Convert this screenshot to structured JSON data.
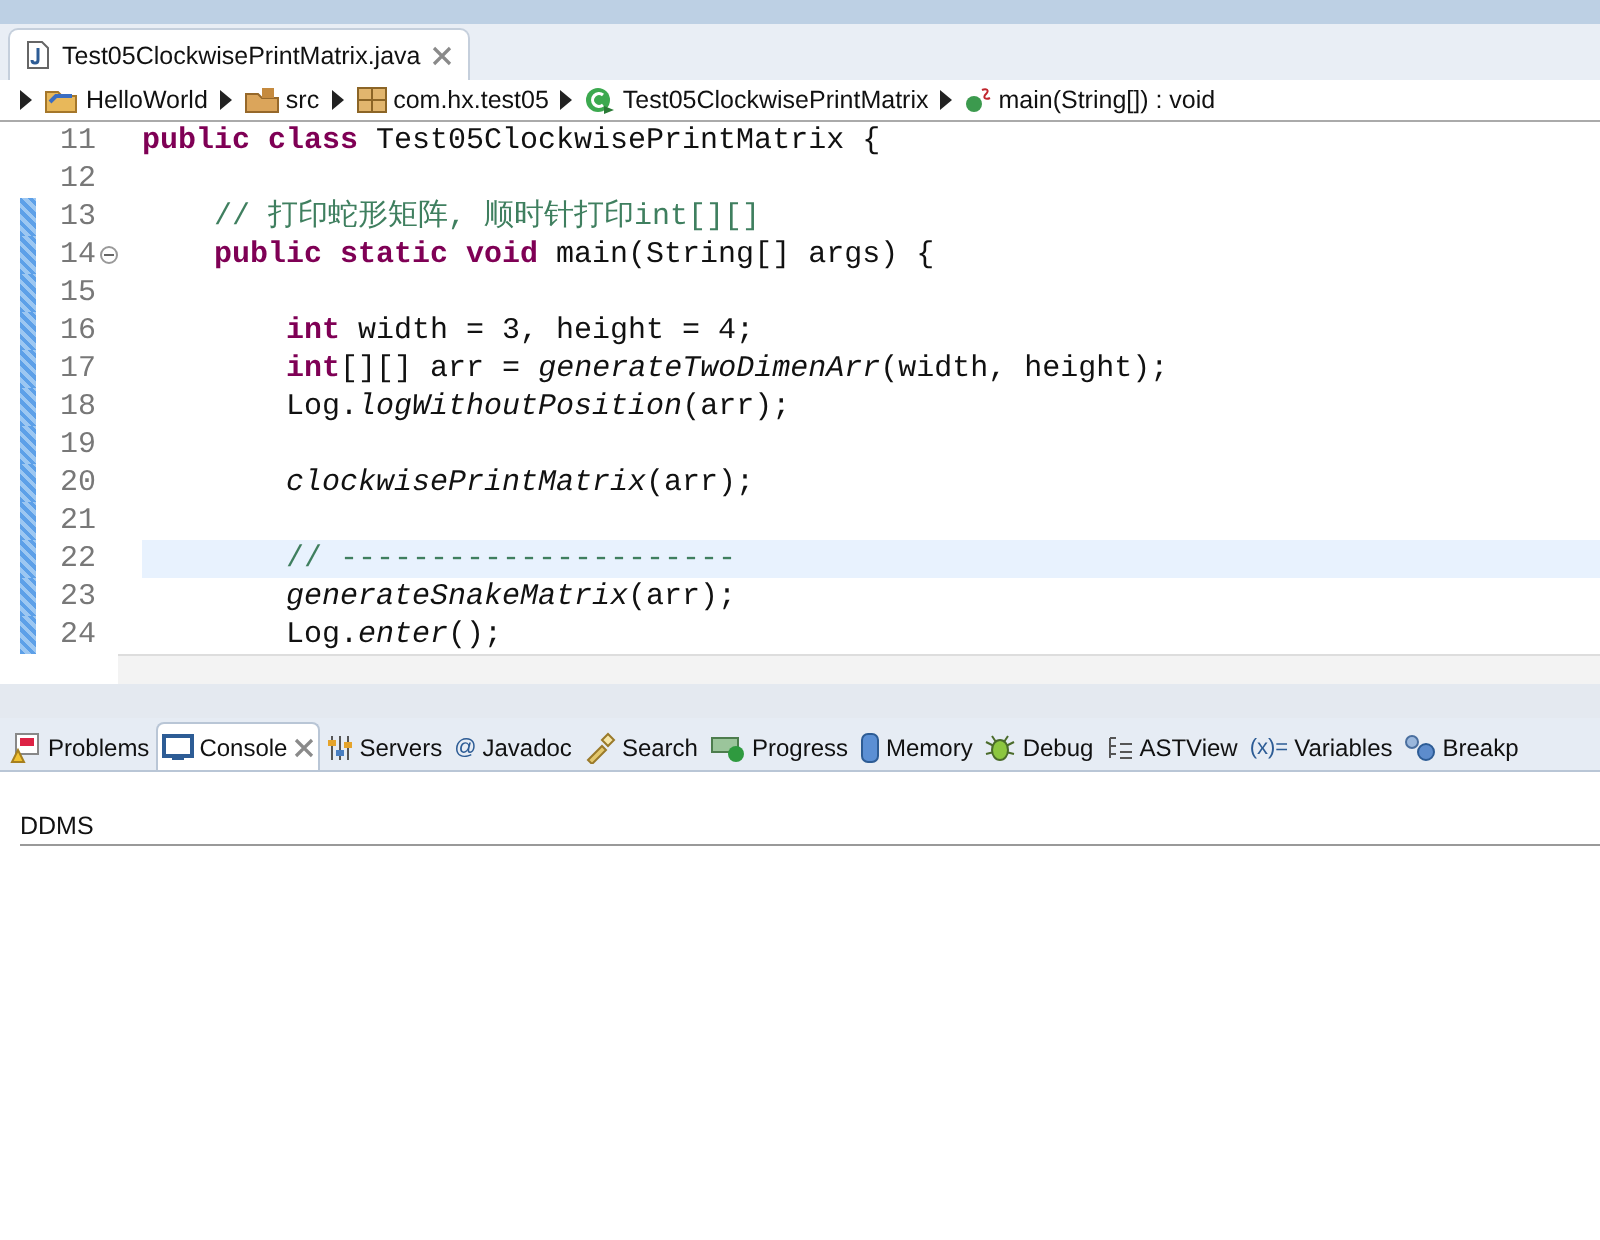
{
  "editor_tab": {
    "label": "Test05ClockwisePrintMatrix.java",
    "selected": true
  },
  "breadcrumb": [
    {
      "kind": "project",
      "label": "HelloWorld"
    },
    {
      "kind": "folder",
      "label": "src"
    },
    {
      "kind": "package",
      "label": "com.hx.test05"
    },
    {
      "kind": "class",
      "label": "Test05ClockwisePrintMatrix"
    },
    {
      "kind": "method",
      "label": "main(String[]) : void"
    }
  ],
  "code_lines": [
    {
      "number": "11",
      "changed": false,
      "current": false,
      "fold": false,
      "tokens": [
        {
          "kind": "keyword",
          "text": "public class "
        },
        {
          "kind": "plain",
          "text": "Test05ClockwisePrintMatrix {"
        }
      ]
    },
    {
      "number": "12",
      "changed": false,
      "current": false,
      "fold": false
    },
    {
      "number": "13",
      "changed": true,
      "current": false,
      "fold": false,
      "tokens": [
        {
          "kind": "comment",
          "text": "    // 打印蛇形矩阵, 顺时针打印int[][]"
        }
      ]
    },
    {
      "number": "14",
      "changed": true,
      "current": false,
      "fold": true,
      "tokens": [
        {
          "kind": "keyword",
          "text": "    public static void "
        },
        {
          "kind": "plain",
          "text": "main(String[] args) {"
        }
      ]
    },
    {
      "number": "15",
      "changed": true,
      "current": false,
      "fold": false
    },
    {
      "number": "16",
      "changed": true,
      "current": false,
      "fold": false,
      "tokens": [
        {
          "kind": "keyword",
          "text": "        int "
        },
        {
          "kind": "plain",
          "text": "width = 3, height = 4;"
        }
      ]
    },
    {
      "number": "17",
      "changed": true,
      "current": false,
      "fold": false,
      "tokens": [
        {
          "kind": "keyword",
          "text": "        int"
        },
        {
          "kind": "plain",
          "text": "[][] arr = "
        },
        {
          "kind": "static",
          "text": "generateTwoDimenArr"
        },
        {
          "kind": "plain",
          "text": "(width, height);"
        }
      ]
    },
    {
      "number": "18",
      "changed": true,
      "current": false,
      "fold": false,
      "tokens": [
        {
          "kind": "plain",
          "text": "        Log."
        },
        {
          "kind": "static",
          "text": "logWithoutPosition"
        },
        {
          "kind": "plain",
          "text": "(arr);"
        }
      ]
    },
    {
      "number": "19",
      "changed": true,
      "current": false,
      "fold": false
    },
    {
      "number": "20",
      "changed": true,
      "current": false,
      "fold": false,
      "tokens": [
        {
          "kind": "static",
          "text": "        clockwisePrintMatrix"
        },
        {
          "kind": "plain",
          "text": "(arr);"
        }
      ]
    },
    {
      "number": "21",
      "changed": true,
      "current": false,
      "fold": false
    },
    {
      "number": "22",
      "changed": true,
      "current": true,
      "fold": false,
      "tokens": [
        {
          "kind": "comment",
          "text": "        // ----------------------"
        }
      ]
    },
    {
      "number": "23",
      "changed": true,
      "current": false,
      "fold": false,
      "tokens": [
        {
          "kind": "static",
          "text": "        generateSnakeMatrix"
        },
        {
          "kind": "plain",
          "text": "(arr);"
        }
      ]
    },
    {
      "number": "24",
      "changed": true,
      "current": false,
      "fold": false,
      "tokens": [
        {
          "kind": "plain",
          "text": "        Log."
        },
        {
          "kind": "static",
          "text": "enter"
        },
        {
          "kind": "plain",
          "text": "();"
        }
      ]
    }
  ],
  "panel_tabs": [
    {
      "kind": "problems",
      "label": "Problems",
      "selected": false
    },
    {
      "kind": "console",
      "label": "Console",
      "selected": true
    },
    {
      "kind": "servers",
      "label": "Servers",
      "selected": false
    },
    {
      "kind": "javadoc",
      "glyph": "@",
      "label": "Javadoc",
      "selected": false
    },
    {
      "kind": "search",
      "label": "Search",
      "selected": false
    },
    {
      "kind": "progress",
      "label": "Progress",
      "selected": false
    },
    {
      "kind": "memory",
      "label": "Memory",
      "selected": false
    },
    {
      "kind": "debug",
      "label": "Debug",
      "selected": false
    },
    {
      "kind": "astview",
      "label": "ASTView",
      "selected": false
    },
    {
      "kind": "variables",
      "glyph": "(x)=",
      "label": "Variables",
      "selected": false
    },
    {
      "kind": "breakpoints",
      "label": "Breakp",
      "selected": false
    }
  ],
  "console": {
    "title": "DDMS"
  }
}
